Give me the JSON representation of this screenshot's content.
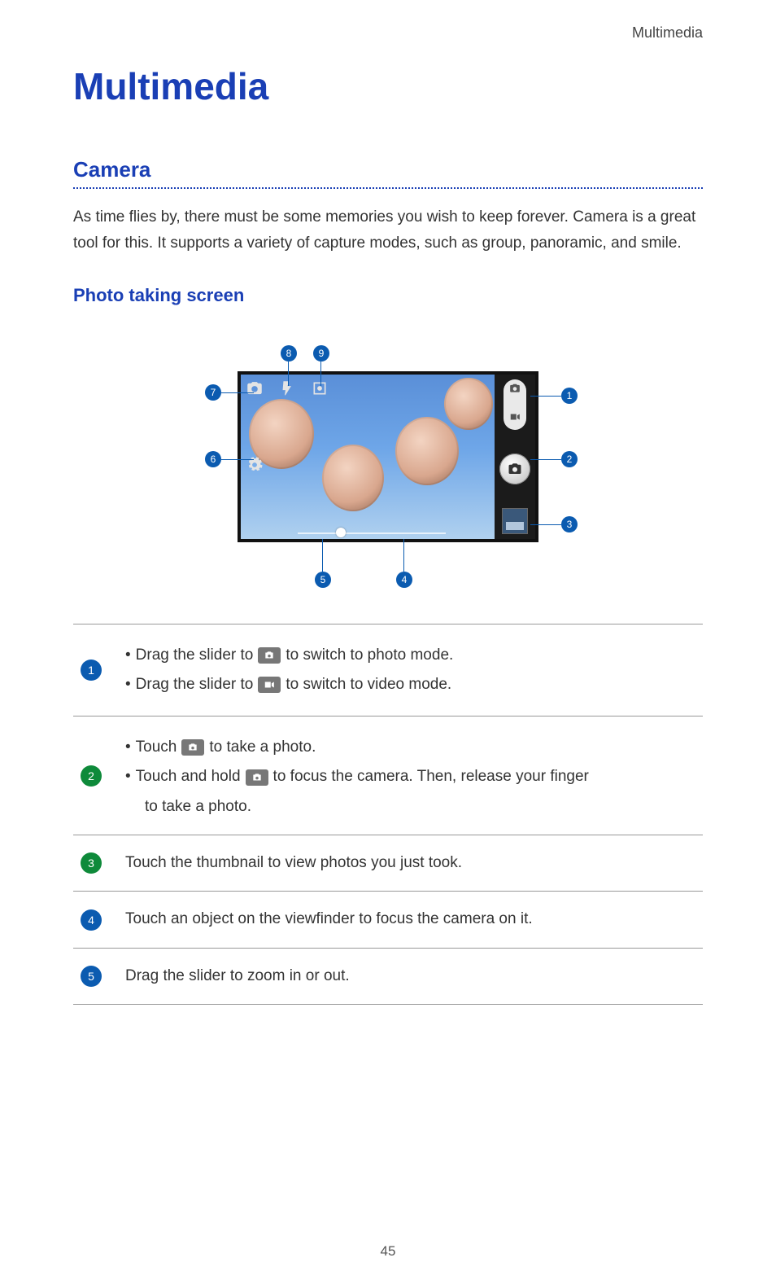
{
  "header": {
    "breadcrumb": "Multimedia"
  },
  "title": "Multimedia",
  "section": {
    "camera_title": "Camera",
    "intro": "As time flies by, there must be some memories you wish to keep forever. Camera is a great tool for this. It supports a variety of capture modes, such as group, panoramic, and smile.",
    "subsection_title": "Photo taking screen"
  },
  "callouts": {
    "c1": "1",
    "c2": "2",
    "c3": "3",
    "c4": "4",
    "c5": "5",
    "c6": "6",
    "c7": "7",
    "c8": "8",
    "c9": "9"
  },
  "legend": {
    "row1": {
      "num": "1",
      "color": "#0b5bb0",
      "a_pre": "Drag the slider to",
      "a_post": "to switch to photo mode.",
      "b_pre": "Drag the slider to",
      "b_post": "to switch to video mode."
    },
    "row2": {
      "num": "2",
      "color": "#0e8a3a",
      "a_pre": "Touch",
      "a_post": "to take a photo.",
      "b_pre": "Touch and hold",
      "b_mid": "to focus the camera. Then, release your finger",
      "b_post": "to take a photo."
    },
    "row3": {
      "num": "3",
      "color": "#0e8a3a",
      "text": "Touch the thumbnail to view photos you just took."
    },
    "row4": {
      "num": "4",
      "color": "#0b5bb0",
      "text": "Touch an object on the viewfinder to focus the camera on it."
    },
    "row5": {
      "num": "5",
      "color": "#0b5bb0",
      "text": "Drag the slider to zoom in or out."
    }
  },
  "page_number": "45"
}
